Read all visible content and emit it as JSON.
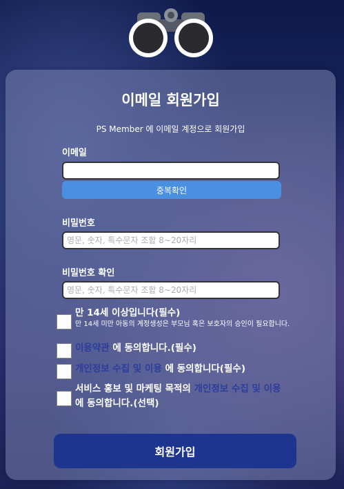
{
  "header": {
    "logo_icon": "binoculars-icon"
  },
  "form": {
    "title": "이메일 회원가입",
    "subtitle": "PS Member 에 이메일 계정으로 회원가입",
    "email": {
      "label": "이메일",
      "value": "",
      "placeholder": ""
    },
    "duplicate_check_label": "중복확인",
    "password": {
      "label": "비밀번호",
      "placeholder": "영문, 숫자, 특수문자 조합 8~20자리"
    },
    "password_confirm": {
      "label": "비밀번호 확인",
      "placeholder": "영문, 숫자, 특수문자 조합 8~20자리"
    },
    "agreements": {
      "age": {
        "text": "만 14세 이상입니다(필수)",
        "note": "만 14세 미만 아동의 계정생성은 부모님 혹은 보호자의 승인이 필요합니다.",
        "checked": false
      },
      "terms": {
        "link": "이용약관",
        "text": " 에 동의합니다.(필수)",
        "checked": false
      },
      "privacy": {
        "link": "개인정보 수집 및 이용",
        "text": " 에 동의합니다(필수)",
        "checked": false
      },
      "marketing": {
        "prefix": "서비스 홍보 및 마케팅 목적의 ",
        "link": "개인정보 수집 및 이용",
        "suffix": " 에 동의합니다.(선택)",
        "checked": false
      }
    },
    "submit_label": "회원가입"
  },
  "colors": {
    "primary": "#1e3590",
    "accent": "#4a8fe0",
    "link": "#2c3d9c"
  }
}
